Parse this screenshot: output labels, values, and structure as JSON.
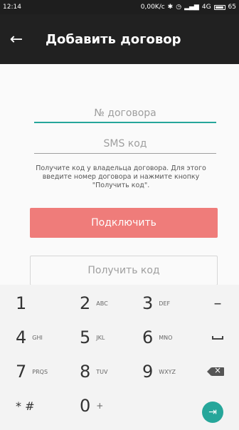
{
  "status_bar": {
    "time": "12:14",
    "speed": "0,00K/c",
    "network": "4G",
    "battery": "65"
  },
  "app_bar": {
    "back_icon": "arrow-left-icon",
    "title": "Добавить договор"
  },
  "form": {
    "contract_placeholder": "№ договора",
    "contract_value": "",
    "sms_placeholder": "SMS код",
    "sms_value": "",
    "hint": "Получите код у владельца договора. Для этого введите номер договора и нажмите кнопку \"Получить код\".",
    "connect_label": "Подключить",
    "get_code_label": "Получить код"
  },
  "keypad": {
    "k1": {
      "digit": "1",
      "letters": ""
    },
    "k2": {
      "digit": "2",
      "letters": "ABC"
    },
    "k3": {
      "digit": "3",
      "letters": "DEF"
    },
    "k4": {
      "digit": "4",
      "letters": "GHI"
    },
    "k5": {
      "digit": "5",
      "letters": "JKL"
    },
    "k6": {
      "digit": "6",
      "letters": "MNO"
    },
    "k7": {
      "digit": "7",
      "letters": "PRQS"
    },
    "k8": {
      "digit": "8",
      "letters": "TUV"
    },
    "k9": {
      "digit": "9",
      "letters": "WXYZ"
    },
    "kstar": {
      "digit": "* #",
      "letters": ""
    },
    "k0": {
      "digit": "0",
      "letters": "+"
    },
    "minus": "–",
    "next_icon": "arrow-right-tab-icon"
  },
  "colors": {
    "accent": "#26a69a",
    "connect_button": "#ef7c7a",
    "app_bar": "#212121"
  }
}
